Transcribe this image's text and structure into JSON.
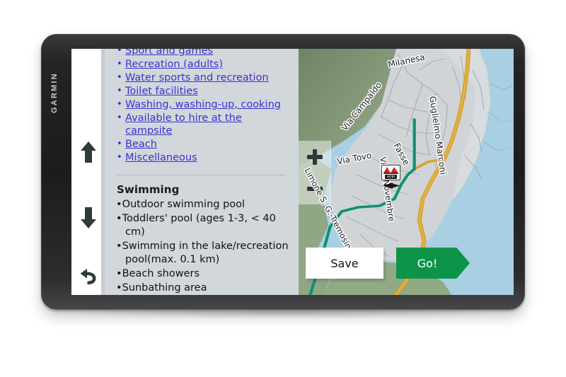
{
  "device": {
    "brand": "GARMIN"
  },
  "controls": {
    "scroll_up": "scroll-up",
    "scroll_down": "scroll-down",
    "back": "back"
  },
  "info_panel": {
    "links": [
      "Sport and games",
      "Recreation (adults)",
      "Water sports and recreation",
      "Toilet facilities",
      "Washing, washing-up, cooking",
      "Available to hire at the campsite",
      "Beach",
      "Miscellaneous"
    ],
    "section_heading": "Swimming",
    "section_items": [
      "Outdoor swimming pool",
      "Toddlers' pool (ages 1-3, < 40 cm)",
      "Swimming in the lake/recreation pool(max. 0.1 km)",
      "Beach showers",
      "Sunbathing area"
    ]
  },
  "map": {
    "zoom_in_label": "+",
    "zoom_out_label": "−",
    "street_labels": [
      "Milanesa",
      "Via Campaldo",
      "Guglielmo Marconi",
      "Via Tovo",
      "Fasse",
      "Via 4 Novembre",
      "Limone S. G.-Tremosine"
    ],
    "poi_marker": "ACSI",
    "colors": {
      "water": "#a9cfe3",
      "land": "#d0d4d6",
      "forest": "#7d9472",
      "major_road": "#e0a52f",
      "route": "#0f9177",
      "go_button": "#0e9448"
    }
  },
  "actions": {
    "save_label": "Save",
    "go_label": "Go!"
  }
}
